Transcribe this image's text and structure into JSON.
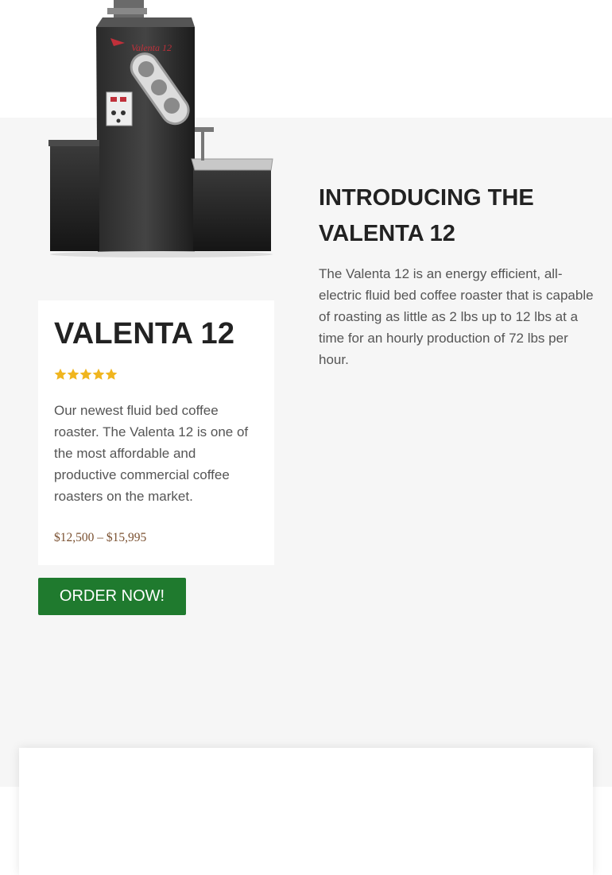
{
  "product": {
    "image_alt": "Valenta 12 coffee roaster",
    "image_brand_text": "Valenta 12",
    "name": "VALENTA 12",
    "rating_stars": 5,
    "rating_max": 5,
    "description": "Our newest fluid bed coffee roaster. The Valenta 12 is one of the most affordable and productive commercial coffee roasters on the market.",
    "price": "$12,500 – $15,995"
  },
  "cta": {
    "label": "ORDER NOW!"
  },
  "intro": {
    "heading": "INTRODUCING THE VALENTA 12",
    "body": "The Valenta 12 is an energy efficient, all-electric fluid bed coffee roaster that is capable of roasting as little as 2 lbs up to 12 lbs at a time for an hourly production of 72 lbs per hour."
  },
  "colors": {
    "star": "#f0b51e",
    "button_bg": "#1f7a2e",
    "price": "#7a5030",
    "section_bg": "#f6f6f6"
  }
}
